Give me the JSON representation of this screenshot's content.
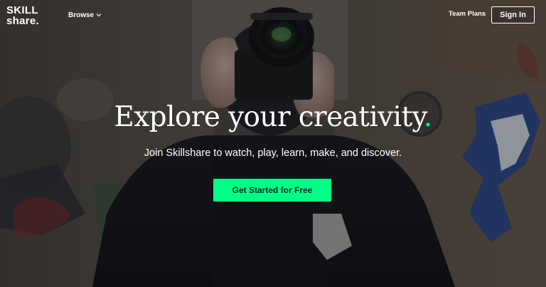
{
  "brand": {
    "logo_line1": "SKILL",
    "logo_line2": "share.",
    "accent_color": "#00ff84"
  },
  "nav": {
    "browse_label": "Browse",
    "browse_icon": "chevron-down-icon",
    "team_plans_label": "Team Plans",
    "sign_in_label": "Sign In"
  },
  "hero": {
    "headline": "Explore your creativity",
    "headline_dot": ".",
    "subheadline": "Join Skillshare to watch, play, learn, make, and discover.",
    "cta_label": "Get Started for Free",
    "background_description_icon": "photographer-with-camera-image"
  }
}
